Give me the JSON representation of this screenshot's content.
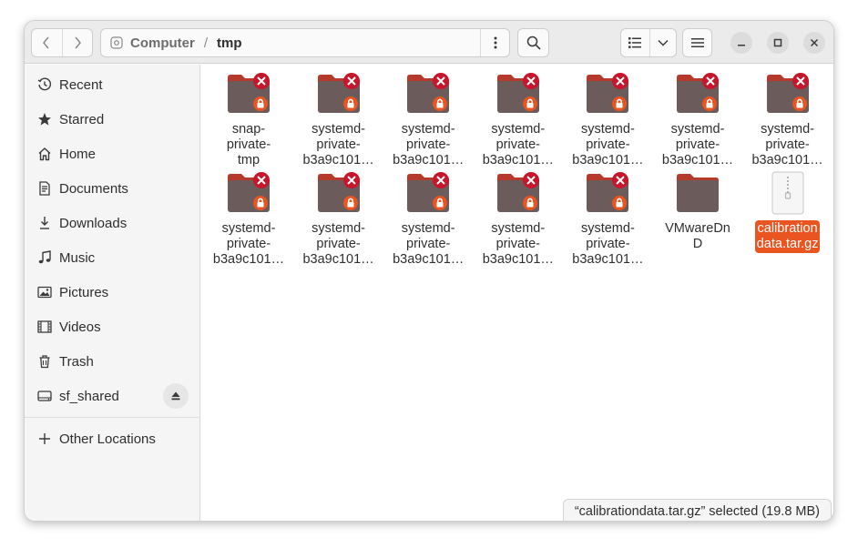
{
  "colors": {
    "accent": "#e95420",
    "folder": "#6b5b5b",
    "folder_tab": "#b53a2c",
    "emblem_red": "#c7162b",
    "emblem_orange": "#e95420"
  },
  "header": {
    "back_icon": "chevron-left-icon",
    "forward_icon": "chevron-right-icon",
    "path": {
      "root": "Computer",
      "separator": "/",
      "current": "tmp"
    },
    "path_menu_icon": "vertical-dots-icon",
    "search_icon": "search-icon",
    "view_icon": "list-view-icon",
    "view_dropdown_icon": "chevron-down-icon",
    "menu_icon": "hamburger-icon",
    "window_controls": [
      "minimize-icon",
      "maximize-icon",
      "close-icon"
    ]
  },
  "sidebar": {
    "items": [
      {
        "label": "Recent",
        "icon": "clock-icon"
      },
      {
        "label": "Starred",
        "icon": "star-icon"
      },
      {
        "label": "Home",
        "icon": "home-icon"
      },
      {
        "label": "Documents",
        "icon": "document-icon"
      },
      {
        "label": "Downloads",
        "icon": "download-icon"
      },
      {
        "label": "Music",
        "icon": "music-icon"
      },
      {
        "label": "Pictures",
        "icon": "picture-icon"
      },
      {
        "label": "Videos",
        "icon": "video-icon"
      },
      {
        "label": "Trash",
        "icon": "trash-icon"
      },
      {
        "label": "sf_shared",
        "icon": "drive-icon"
      }
    ],
    "other_locations": {
      "label": "Other Locations",
      "icon": "plus-icon"
    }
  },
  "files": [
    {
      "lines": [
        "snap-",
        "private-",
        "tmp"
      ],
      "type": "folder-locked"
    },
    {
      "lines": [
        "systemd-",
        "private-",
        "b3a9c101…"
      ],
      "type": "folder-locked"
    },
    {
      "lines": [
        "systemd-",
        "private-",
        "b3a9c101…"
      ],
      "type": "folder-locked"
    },
    {
      "lines": [
        "systemd-",
        "private-",
        "b3a9c101…"
      ],
      "type": "folder-locked"
    },
    {
      "lines": [
        "systemd-",
        "private-",
        "b3a9c101…"
      ],
      "type": "folder-locked"
    },
    {
      "lines": [
        "systemd-",
        "private-",
        "b3a9c101…"
      ],
      "type": "folder-locked"
    },
    {
      "lines": [
        "systemd-",
        "private-",
        "b3a9c101…"
      ],
      "type": "folder-locked"
    },
    {
      "lines": [
        "systemd-",
        "private-",
        "b3a9c101…"
      ],
      "type": "folder-locked"
    },
    {
      "lines": [
        "systemd-",
        "private-",
        "b3a9c101…"
      ],
      "type": "folder-locked"
    },
    {
      "lines": [
        "systemd-",
        "private-",
        "b3a9c101…"
      ],
      "type": "folder-locked"
    },
    {
      "lines": [
        "systemd-",
        "private-",
        "b3a9c101…"
      ],
      "type": "folder-locked"
    },
    {
      "lines": [
        "systemd-",
        "private-",
        "b3a9c101…"
      ],
      "type": "folder-locked"
    },
    {
      "lines": [
        "VMwareDn",
        "D"
      ],
      "type": "folder"
    },
    {
      "lines": [
        "calibration",
        "data.tar.gz"
      ],
      "type": "archive",
      "selected": true
    }
  ],
  "status": {
    "text": "“calibrationdata.tar.gz” selected  (19.8 MB)"
  }
}
